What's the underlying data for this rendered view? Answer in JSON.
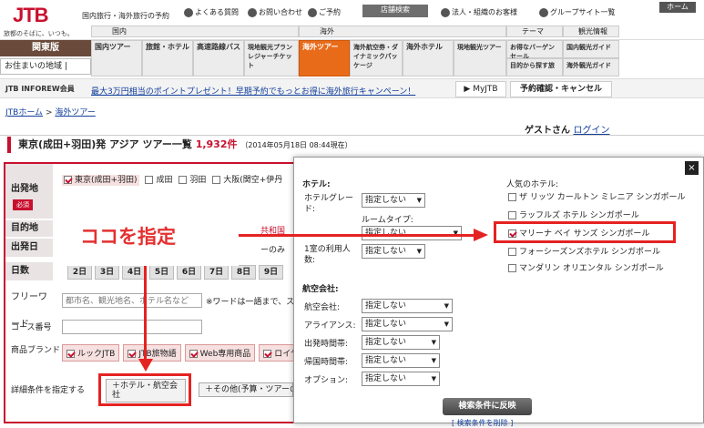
{
  "header": {
    "logo_text": "JTB",
    "logo_sub": "旅都のそばに、いつも。",
    "site_label": "国内旅行・海外旅行の予約",
    "faq": "よくある質問",
    "contact": "お問い合わせ",
    "reservation_link": "ご予約",
    "store_search": "店舗検索",
    "corporate": "法人・組織のお客様",
    "group": "グループサイト一覧",
    "home": "ホーム",
    "domestic_label": "国内",
    "overseas_label": "海外",
    "theme_label": "テーマ",
    "guide_label": "観光情報",
    "region_main": "関東版",
    "region_sub": "お住まいの地域 |"
  },
  "nav": [
    "国内ツアー",
    "旅館・ホテル",
    "高速路線バス",
    "現地観光プランレジャーチケット",
    "海外ツアー",
    "海外航空券・ダイナミックパッケージ",
    "海外ホテル",
    "現地観光ツアー",
    "お得なバーゲンセール",
    "目的から探す旅",
    "国内観光ガイド",
    "海外観光ガイド"
  ],
  "strip": {
    "member_logo": "JTB INFOREW会員",
    "promo": "最大3万円相当のポイントプレゼント！早期予約でもっとお得に海外旅行キャンペーン！",
    "myjtb": "MyJTB",
    "confirm": "予約確認・キャンセル"
  },
  "breadcrumb": {
    "home": "JTBホーム",
    "sep": ">",
    "current": "海外ツアー"
  },
  "guest": {
    "name": "ゲストさん",
    "login": "ログイン"
  },
  "page_title": {
    "text": "東京(成田+羽田)発 アジア ツアー一覧",
    "count": "1,932件",
    "date": "（2014年05月18日 08:44現在）"
  },
  "form": {
    "departure_label": "出発地",
    "required": "必須",
    "departures": [
      "東京(成田+羽田)",
      "成田",
      "羽田",
      "大阪(関空+伊丹"
    ],
    "destination_label": "目的地",
    "destination_value": "共和国",
    "depart_date_label": "出発日",
    "depart_date_value": "ーのみ",
    "days_label": "日数",
    "days": [
      "2日",
      "3日",
      "4日",
      "5日",
      "6日",
      "7日",
      "8日",
      "9日"
    ],
    "freeword_label": "フリーワード",
    "freeword_placeholder": "都市名、観光地名、ホテル名など",
    "freeword_note": "※ワードは一語まで、ス",
    "course_label": "コース番号",
    "brand_label": "商品ブランド",
    "brands": [
      "ルックJTB",
      "JTB旅物語",
      "Web専用商品",
      "ロイヤ"
    ],
    "detail_label": "詳細条件を指定する",
    "hotel_air_btn": "ホテル・航空会社",
    "other_btn": "その他(予算・ツアーの"
  },
  "overlay": {
    "hotel_heading": "ホテル:",
    "grade_label": "ホテルグレード:",
    "grade_value": "指定しない",
    "room_type_label": "ルームタイプ:",
    "room_type_value": "指定しない",
    "guests_label": "1室の利用人数:",
    "guests_value": "指定しない",
    "airline_heading": "航空会社:",
    "air_labels": [
      "航空会社:",
      "アライアンス:",
      "出発時間帯:",
      "帰国時間帯:",
      "オプション:"
    ],
    "air_values": [
      "指定しない",
      "指定しない",
      "指定しない",
      "指定しない",
      "指定しない"
    ],
    "popular_heading": "人気のホテル:",
    "hotels": [
      {
        "name": "ザ リッツ カールトン ミレニア シンガポール",
        "checked": false
      },
      {
        "name": "ラッフルズ ホテル シンガポール",
        "checked": false
      },
      {
        "name": "マリーナ ベイ サンズ シンガポール",
        "checked": true
      },
      {
        "name": "フォーシーズンズホテル シンガポール",
        "checked": false
      },
      {
        "name": "マンダリン オリエンタル シンガポール",
        "checked": false
      }
    ],
    "apply_button": "検索条件に反映",
    "close": "×",
    "footer_link": "[ 検索条件を削除 ]"
  },
  "annotation": {
    "text": "ココを指定",
    "color": "#e52222"
  }
}
